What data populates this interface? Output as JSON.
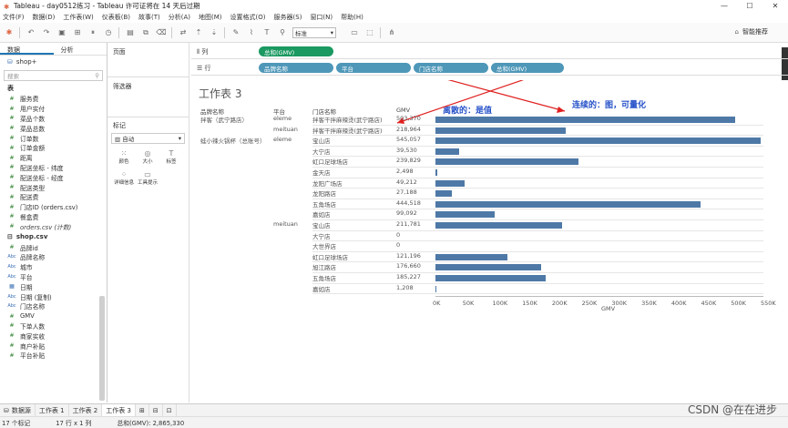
{
  "window": {
    "title": "Tableau - day0512练习 - Tableau 许可证将在 14 天后过期"
  },
  "menu": [
    "文件(F)",
    "数据(D)",
    "工作表(W)",
    "仪表板(B)",
    "故事(T)",
    "分析(A)",
    "地图(M)",
    "设置格式(O)",
    "服务器(S)",
    "窗口(N)",
    "帮助(H)"
  ],
  "toolbar": {
    "fit": "标准",
    "zhiyan": "智能推荐"
  },
  "leftpane": {
    "tab_data": "数据",
    "tab_analysis": "分析",
    "source": "shop+",
    "search_placeholder": "搜索",
    "section_table": "表",
    "fields1": [
      {
        "icon": "#",
        "name": "服务费"
      },
      {
        "icon": "#",
        "name": "用户实付"
      },
      {
        "icon": "#",
        "name": "菜品个数"
      },
      {
        "icon": "#",
        "name": "菜品总数"
      },
      {
        "icon": "#",
        "name": "订单数"
      },
      {
        "icon": "#",
        "name": "订单金额"
      },
      {
        "icon": "#",
        "name": "距离"
      },
      {
        "icon": "#",
        "name": "配送坐标 - 纬度"
      },
      {
        "icon": "#",
        "name": "配送坐标 - 经度"
      },
      {
        "icon": "#",
        "name": "配送类型"
      },
      {
        "icon": "#",
        "name": "配送费"
      },
      {
        "icon": "#",
        "name": "门店ID (orders.csv)"
      },
      {
        "icon": "#",
        "name": "餐盒费"
      },
      {
        "icon": "#",
        "name": "orders.csv (计数)",
        "italic": true
      }
    ],
    "section_shop": "shop.csv",
    "fields2": [
      {
        "icon": "#",
        "name": "品牌id"
      },
      {
        "icon": "Abc",
        "name": "品牌名称"
      },
      {
        "icon": "Abc",
        "name": "城市"
      },
      {
        "icon": "Abc",
        "name": "平台"
      },
      {
        "icon": "▦",
        "name": "日期"
      },
      {
        "icon": "Abc",
        "name": "日期 (复制)"
      },
      {
        "icon": "Abc",
        "name": "门店名称"
      },
      {
        "icon": "#",
        "name": "GMV"
      },
      {
        "icon": "#",
        "name": "下单人数"
      },
      {
        "icon": "#",
        "name": "商家实收"
      },
      {
        "icon": "#",
        "name": "商户补贴"
      },
      {
        "icon": "#",
        "name": "平台补贴"
      }
    ]
  },
  "cards": {
    "pages": "页面",
    "filters": "筛选器",
    "marks": "标记",
    "mark_type": "自动",
    "mark_buttons": [
      "颜色",
      "大小",
      "标签",
      "详细信息",
      "工具提示"
    ]
  },
  "shelves": {
    "columns_label": "列",
    "rows_label": "行",
    "columns": [
      "总和(GMV)"
    ],
    "rows": [
      "品牌名称",
      "平台",
      "门店名称",
      "总和(GMV)"
    ]
  },
  "view": {
    "title": "工作表 3",
    "headers": [
      "品牌名称",
      "平台",
      "门店名称",
      "GMV"
    ],
    "rows": [
      {
        "brand": "拌客（武宁路店）",
        "platform": "eleme",
        "store": "拌客干拌麻辣烫(武宁路店)",
        "gmv": "503,370",
        "value": 503370
      },
      {
        "brand": "",
        "platform": "meituan",
        "store": "拌客干拌麻辣烫(武宁路店)",
        "gmv": "218,964",
        "value": 218964
      },
      {
        "brand": "蛙小辣火锅杯（总账号）",
        "platform": "eleme",
        "store": "宝山店",
        "gmv": "545,057",
        "value": 545057
      },
      {
        "brand": "",
        "platform": "",
        "store": "大宁店",
        "gmv": "39,530",
        "value": 39530
      },
      {
        "brand": "",
        "platform": "",
        "store": "虹口足球场店",
        "gmv": "239,829",
        "value": 239829
      },
      {
        "brand": "",
        "platform": "",
        "store": "金天店",
        "gmv": "2,498",
        "value": 2498
      },
      {
        "brand": "",
        "platform": "",
        "store": "龙阳广场店",
        "gmv": "49,212",
        "value": 49212
      },
      {
        "brand": "",
        "platform": "",
        "store": "龙阳路店",
        "gmv": "27,188",
        "value": 27188
      },
      {
        "brand": "",
        "platform": "",
        "store": "五角场店",
        "gmv": "444,518",
        "value": 444518
      },
      {
        "brand": "",
        "platform": "",
        "store": "嘉如店",
        "gmv": "99,092",
        "value": 99092
      },
      {
        "brand": "",
        "platform": "meituan",
        "store": "宝山店",
        "gmv": "211,781",
        "value": 211781
      },
      {
        "brand": "",
        "platform": "",
        "store": "大宁店",
        "gmv": "0",
        "value": 0
      },
      {
        "brand": "",
        "platform": "",
        "store": "大世界店",
        "gmv": "0",
        "value": 0
      },
      {
        "brand": "",
        "platform": "",
        "store": "虹口足球场店",
        "gmv": "121,196",
        "value": 121196
      },
      {
        "brand": "",
        "platform": "",
        "store": "旭江路店",
        "gmv": "176,660",
        "value": 176660
      },
      {
        "brand": "",
        "platform": "",
        "store": "五角场店",
        "gmv": "185,227",
        "value": 185227
      },
      {
        "brand": "",
        "platform": "",
        "store": "嘉如店",
        "gmv": "1,208",
        "value": 1208
      }
    ],
    "axis_ticks": [
      "0K",
      "50K",
      "100K",
      "150K",
      "200K",
      "250K",
      "300K",
      "350K",
      "400K",
      "450K",
      "500K",
      "550K"
    ],
    "axis_max": 550000,
    "axis_label": "GMV"
  },
  "annotations": {
    "discrete": "离散的：是值",
    "continuous": "连续的：图，可量化"
  },
  "sheets": {
    "source": "数据源",
    "tabs": [
      "工作表 1",
      "工作表 2",
      "工作表 3"
    ]
  },
  "status": {
    "marks": "17 个标记",
    "rows": "17 行 x 1 列",
    "sum": "总和(GMV): 2,865,330"
  },
  "watermark": "CSDN @在在进步",
  "colors": {
    "bar": "#4e79a7",
    "measure_pill": "#1a9960",
    "dimension_pill": "#4e97b8",
    "annotation": "#2450c8",
    "arrow": "#e02020"
  }
}
